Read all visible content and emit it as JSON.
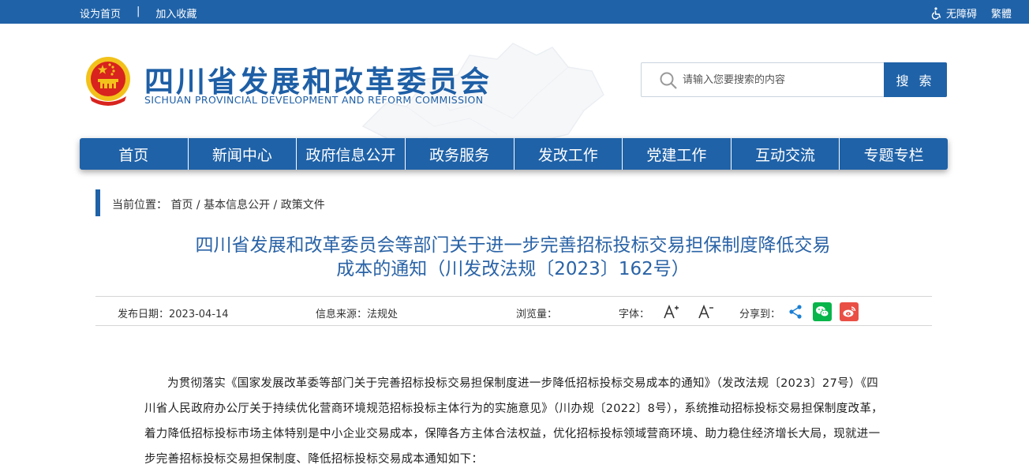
{
  "topbar": {
    "set_home": "设为首页",
    "separator": "|",
    "add_favorite": "加入收藏",
    "accessibility": "无障碍",
    "traditional": "繁體"
  },
  "header": {
    "title": "四川省发展和改革委员会",
    "subtitle": "SICHUAN PROVINCIAL DEVELOPMENT AND REFORM COMMISSION",
    "search_placeholder": "请输入您要搜索的内容",
    "search_button": "搜 索"
  },
  "nav": {
    "items": [
      "首页",
      "新闻中心",
      "政府信息公开",
      "政务服务",
      "发改工作",
      "党建工作",
      "互动交流",
      "专题专栏"
    ]
  },
  "breadcrumb": {
    "label": "当前位置：",
    "home": "首页",
    "sep": " / ",
    "level1": "基本信息公开",
    "level2": "政策文件"
  },
  "article": {
    "title_line1": "四川省发展和改革委员会等部门关于进一步完善招标投标交易担保制度降低交易",
    "title_line2": "成本的通知（川发改法规〔2023〕162号）",
    "publish_date_label": "发布日期：",
    "publish_date": "2023-04-14",
    "source_label": "信息来源：",
    "source": "法规处",
    "views_label": "浏览量：",
    "font_label": "字体：",
    "font_up": "A+",
    "font_down": "A-",
    "share_label": "分享到：",
    "paragraph": "为贯彻落实《国家发展改革委等部门关于完善招标投标交易担保制度进一步降低招标投标交易成本的通知》（发改法规〔2023〕27号）《四川省人民政府办公厅关于持续优化营商环境规范招标投标主体行为的实施意见》（川办规〔2022〕8号），系统推动招标投标交易担保制度改革，着力降低招标投标市场主体特别是中小企业交易成本，保障各方主体合法权益，优化招标投标领域营商环境、助力稳住经济增长大局，现就进一步完善招标投标交易担保制度、降低招标投标交易成本通知如下："
  },
  "colors": {
    "brand_blue": "#1f62a8",
    "title_blue": "#2a63a6",
    "emblem_red": "#d8231e",
    "emblem_gold": "#f2c21b",
    "wechat_green": "#07b54a",
    "weibo_red": "#e94f45",
    "share_blue": "#1a7fd4"
  }
}
